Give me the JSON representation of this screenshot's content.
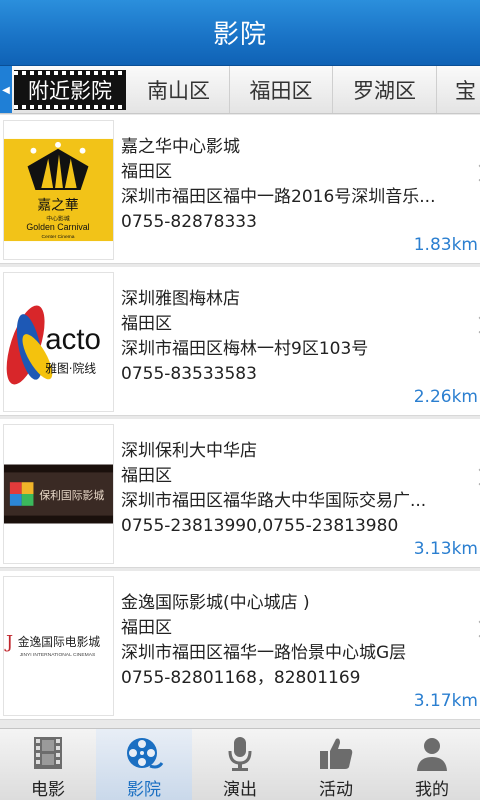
{
  "header": {
    "title": "影院"
  },
  "tabs": [
    {
      "label": "附近影院",
      "active": true
    },
    {
      "label": "南山区"
    },
    {
      "label": "福田区"
    },
    {
      "label": "罗湖区"
    },
    {
      "label": "宝"
    }
  ],
  "cinemas": [
    {
      "name": "嘉之华中心影城",
      "district": "福田区",
      "address": "深圳市福田区福中一路2016号深圳音乐...",
      "phone": "0755-82878333",
      "distance": "1.83km",
      "logo": {
        "brand_cn": "嘉之華",
        "sub_cn": "中心影城",
        "brand_en": "Golden Carnival",
        "sub_en": "Center Cinema"
      }
    },
    {
      "name": "深圳雅图梅林店",
      "district": "福田区",
      "address": "深圳市福田区梅林一村9区103号",
      "phone": "0755-83533583",
      "distance": "2.26km",
      "logo": {
        "brand_en": "acto",
        "brand_cn": "雅图·院线"
      }
    },
    {
      "name": "深圳保利大中华店",
      "district": "福田区",
      "address": "深圳市福田区福华路大中华国际交易广...",
      "phone": "0755-23813990,0755-23813980",
      "distance": "3.13km",
      "logo": {
        "brand_cn": "保利国际影城"
      }
    },
    {
      "name": "金逸国际影城(中心城店 )",
      "district": "福田区",
      "address": "深圳市福田区福华一路怡景中心城G层",
      "phone": "0755-82801168，82801169",
      "distance": "3.17km",
      "logo": {
        "brand_cn": "金逸国际电影城",
        "brand_en": "JINYI INTERNATIONAL CINEMAS"
      }
    }
  ],
  "bottom_nav": [
    {
      "label": "电影",
      "icon": "film-icon"
    },
    {
      "label": "影院",
      "icon": "film-reel-icon",
      "active": true
    },
    {
      "label": "演出",
      "icon": "microphone-icon"
    },
    {
      "label": "活动",
      "icon": "thumbs-up-icon"
    },
    {
      "label": "我的",
      "icon": "user-icon"
    }
  ],
  "colors": {
    "header_blue": "#1a74c7",
    "distance_blue": "#2b7fd0",
    "active_tab": "#111111"
  }
}
